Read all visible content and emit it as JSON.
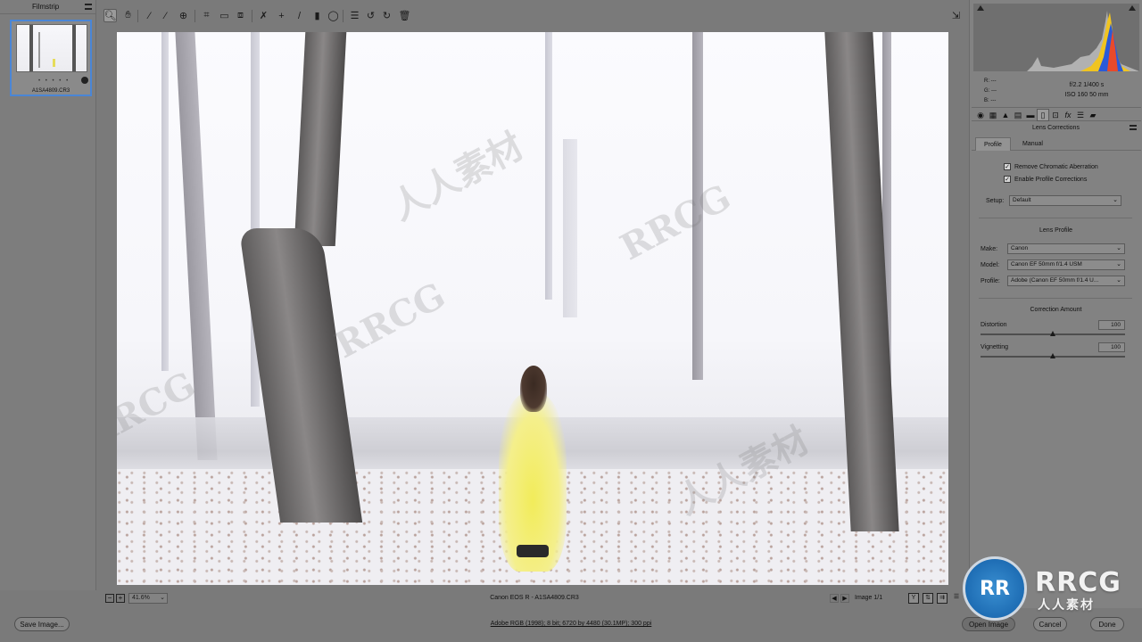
{
  "filmstrip": {
    "title": "Filmstrip",
    "thumbnail": {
      "filename": "A1SA4809.CR3",
      "rating_dots": "• • • • •"
    }
  },
  "toolbar": {
    "tools": [
      {
        "icon": "zoom-icon",
        "glyph": "🔍︎",
        "active": true
      },
      {
        "icon": "hand-icon",
        "glyph": "✋︎"
      },
      {
        "icon": "white-balance-icon",
        "glyph": "⁄"
      },
      {
        "icon": "color-sampler-icon",
        "glyph": "⁄"
      },
      {
        "icon": "targeted-adjustment-icon",
        "glyph": "⊕"
      },
      {
        "icon": "crop-icon",
        "glyph": "⌗"
      },
      {
        "icon": "straighten-icon",
        "glyph": "▭"
      },
      {
        "icon": "transform-icon",
        "glyph": "⧈"
      },
      {
        "icon": "spot-removal-icon",
        "glyph": "✗"
      },
      {
        "icon": "red-eye-icon",
        "glyph": "+"
      },
      {
        "icon": "adjustment-brush-icon",
        "glyph": "/"
      },
      {
        "icon": "graduated-filter-icon",
        "glyph": "▮"
      },
      {
        "icon": "radial-filter-icon",
        "glyph": "◯"
      },
      {
        "icon": "preferences-icon",
        "glyph": "☰"
      },
      {
        "icon": "rotate-left-icon",
        "glyph": "↺"
      },
      {
        "icon": "rotate-right-icon",
        "glyph": "↻"
      },
      {
        "icon": "trash-icon",
        "glyph": "🗑︎"
      }
    ],
    "fullscreen_glyph": "⇲"
  },
  "canvas_bar": {
    "zoom_out": "−",
    "zoom_in": "+",
    "zoom_value": "41.6%",
    "camera_label": "Canon EOS R  -  A1SA4809.CR3",
    "image_count": "Image 1/1",
    "view_y": "Y",
    "prev": "◀",
    "next": "▶"
  },
  "footer": {
    "save_label": "Save Image...",
    "workflow_info": "Adobe RGB (1998); 8 bit; 6720 by 4480 (30.1MP); 300 ppi",
    "open_label": "Open Image",
    "cancel_label": "Cancel",
    "done_label": "Done"
  },
  "info": {
    "r": "R:   ---",
    "g": "G:   ---",
    "b": "B:   ---",
    "aperture_shutter": "f/2.2    1/400 s",
    "iso_focal": "ISO 160    50 mm"
  },
  "panel": {
    "title": "Lens Corrections",
    "tabs": [
      "Profile",
      "Manual"
    ],
    "remove_ca": "Remove Chromatic Aberration",
    "enable_profile": "Enable Profile Corrections",
    "setup_label": "Setup:",
    "setup_value": "Default",
    "lens_profile_title": "Lens Profile",
    "make_label": "Make:",
    "make_value": "Canon",
    "model_label": "Model:",
    "model_value": "Canon EF 50mm f/1.4 USM",
    "profile_label": "Profile:",
    "profile_value": "Adobe (Canon EF 50mm f/1.4 U...",
    "correction_title": "Correction Amount",
    "distortion_label": "Distortion",
    "distortion_value": "100",
    "vignetting_label": "Vignetting",
    "vignetting_value": "100",
    "check_mark": "✓",
    "dropdown_glyph": "⌄"
  },
  "watermark": {
    "text_latin": "RRCG",
    "text_cn": "人人素材"
  },
  "brand": {
    "logo_text": "RR",
    "name": "RRCG",
    "sub": "人人素材"
  }
}
